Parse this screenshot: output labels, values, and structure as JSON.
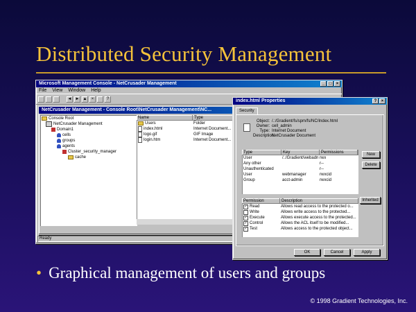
{
  "slide": {
    "title": "Distributed Security Management",
    "bullet": "Graphical management of users and groups",
    "footer": "© 1998 Gradient Technologies, Inc."
  },
  "mmc": {
    "title": "Microsoft Management Console - NetCrusader Management",
    "menu": [
      "File",
      "View",
      "Window",
      "Help"
    ],
    "child_title": "NetCrusader Management - Console Root\\NetCrusader Management\\NC...",
    "tree": [
      "Console Root",
      "NetCrusader Management",
      "Domain1",
      "cells",
      "groups",
      "agents",
      "Cluster_security_manager",
      "cache"
    ],
    "list_headers": [
      "Name",
      "Type"
    ],
    "list_rows": [
      {
        "name": "Users",
        "type": "Folder"
      },
      {
        "name": "index.html",
        "type": "Internet Document..."
      },
      {
        "name": "logo.gif",
        "type": "GIF Image"
      },
      {
        "name": "login.htm",
        "type": "Internet Document..."
      }
    ],
    "status": "Ready"
  },
  "props": {
    "title": "index.html Properties",
    "tab": "Security",
    "fields": [
      {
        "label": "Object:",
        "value": "/.:/Gradient/fs/spm/fs/NC/Index.html"
      },
      {
        "label": "Owner:",
        "value": "cell_admin"
      },
      {
        "label": "Type:",
        "value": "Internet Document"
      },
      {
        "label": "Description:",
        "value": "NetCrusader Document"
      }
    ],
    "acl_headers": [
      "Type",
      "Key",
      "Permissions"
    ],
    "acl_rows": [
      {
        "type": "User",
        "key": "/.:/Gradient/webadmin",
        "perm": "rwx"
      },
      {
        "type": "Any other",
        "key": "",
        "perm": "r--"
      },
      {
        "type": "Unauthenticated",
        "key": "",
        "perm": "r--"
      },
      {
        "type": "User",
        "key": "webmanager",
        "perm": "rwxcid"
      },
      {
        "type": "Group",
        "key": "acct-admin",
        "perm": "rwxcid"
      }
    ],
    "acl_buttons": {
      "new": "New",
      "delete": "Delete",
      "inherited": "Inherited"
    },
    "perm_headers": [
      "Permission",
      "Description"
    ],
    "perm_rows": [
      {
        "checked": true,
        "perm": "Read",
        "desc": "Allows read access to the protected o..."
      },
      {
        "checked": false,
        "perm": "Write",
        "desc": "Allows write access to the protected..."
      },
      {
        "checked": true,
        "perm": "Execute",
        "desc": "Allows execute access to the protected..."
      },
      {
        "checked": true,
        "perm": "Control",
        "desc": "Allows the ACL itself to be modified..."
      },
      {
        "checked": true,
        "perm": "Test",
        "desc": "Allows access to the protected object..."
      }
    ],
    "buttons": {
      "ok": "OK",
      "cancel": "Cancel",
      "apply": "Apply"
    }
  },
  "colors": {
    "title_gold": "#f5c23a",
    "bg_top": "#0b0a3a",
    "bg_bottom": "#2a1478",
    "win_title": "#000080"
  }
}
